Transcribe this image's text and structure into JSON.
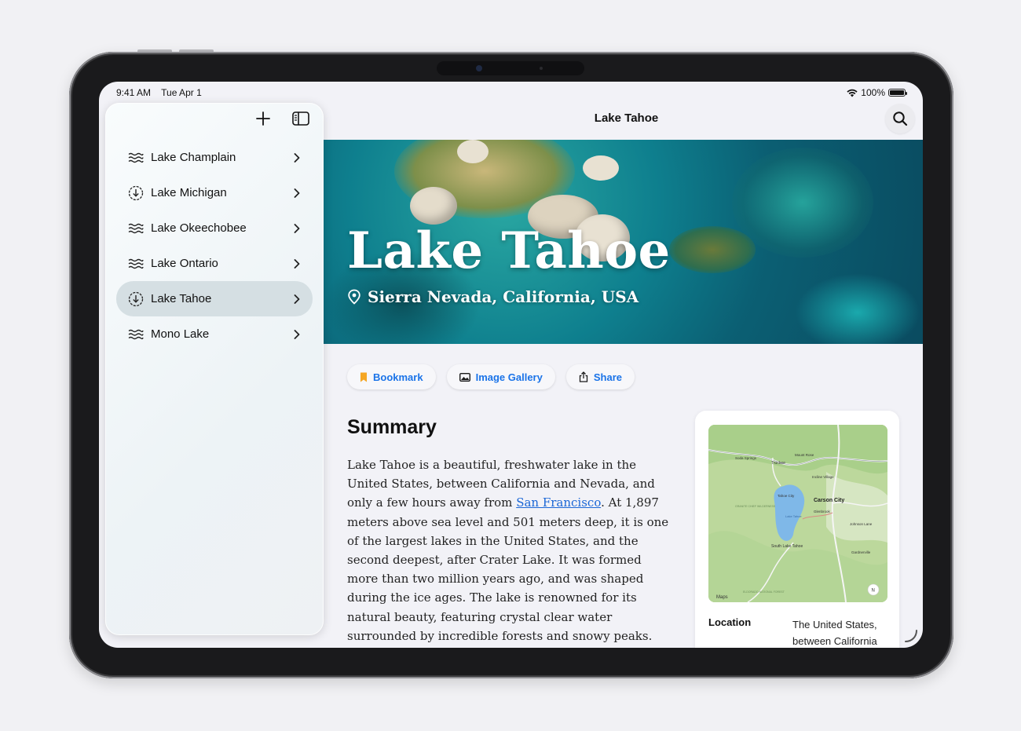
{
  "status": {
    "time": "9:41 AM",
    "date": "Tue Apr 1",
    "battery": "100%"
  },
  "nav": {
    "title": "Lake Tahoe"
  },
  "sidebar": {
    "items": [
      {
        "label": "Lake Champlain",
        "icon": "water-waves-icon"
      },
      {
        "label": "Lake Michigan",
        "icon": "download-circle-icon"
      },
      {
        "label": "Lake Okeechobee",
        "icon": "water-waves-icon"
      },
      {
        "label": "Lake Ontario",
        "icon": "water-waves-icon"
      },
      {
        "label": "Lake Tahoe",
        "icon": "download-circle-icon",
        "selected": true
      },
      {
        "label": "Mono Lake",
        "icon": "water-waves-icon"
      }
    ]
  },
  "hero": {
    "title": "Lake Tahoe",
    "subtitle": "Sierra Nevada, California, USA"
  },
  "actions": {
    "bookmark": "Bookmark",
    "gallery": "Image Gallery",
    "share": "Share"
  },
  "summary": {
    "heading": "Summary",
    "text_before": "Lake Tahoe is a beautiful, freshwater lake in the United States, between California and Nevada, and only a few hours away from ",
    "link": "San Francisco",
    "text_after": ". At 1,897 meters above sea level and 501 meters deep, it is one of the largest lakes in the United States, and the second deepest, after Crater Lake. It was formed more than two million years ago, and was shaped during the ice ages. The lake is renowned for its natural beauty, featuring crystal clear water surrounded by incredible forests and snowy peaks. Lake Tahoe features incredible clarity, allowing visibility up to"
  },
  "info": {
    "location_label": "Location",
    "location_value": "The United States, between California",
    "map_labels": {
      "carson": "Carson City",
      "truckee": "Truckee",
      "south_tahoe": "South Lake Tahoe",
      "incline": "Incline Village",
      "tahoe_city": "Tahoe City",
      "glenbrook": "Glenbrook",
      "johnson": "Johnson Lane",
      "gardnerville": "Gardnerville",
      "mount_rose": "Mount Rose",
      "soda": "Soda Springs",
      "maps": "Maps",
      "lake": "Lake Tahoe",
      "wilderness": "GRANITE CHIEF WILDERNESS",
      "eldorado": "ELDORADO NATIONAL FOREST",
      "north": "N"
    }
  },
  "colors": {
    "accent": "#1a73e8",
    "bookmark": "#f5a623",
    "selected": "#d5dfe3"
  }
}
